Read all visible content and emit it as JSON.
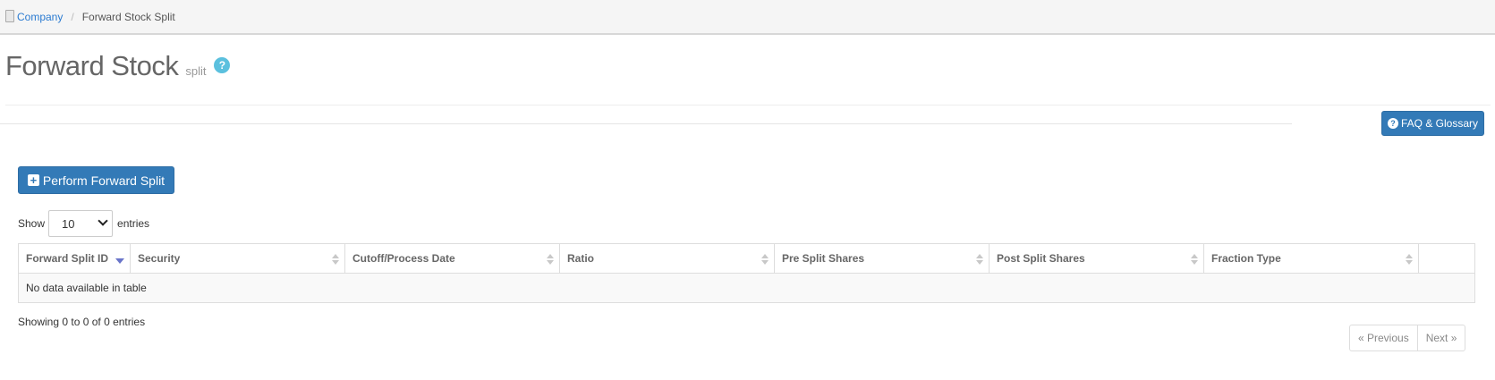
{
  "breadcrumb": {
    "items": [
      {
        "label": "Company"
      },
      {
        "label": "Forward Stock Split"
      }
    ],
    "separator": "/"
  },
  "header": {
    "title": "Forward Stock",
    "subtitle": "split",
    "help_glyph": "?"
  },
  "toolbar": {
    "faq_label": "FAQ & Glossary",
    "faq_icon_glyph": "?",
    "perform_label": "Perform Forward Split",
    "perform_icon_glyph": "+"
  },
  "length_menu": {
    "prefix": "Show",
    "selected": "10",
    "suffix": "entries"
  },
  "table": {
    "columns": [
      {
        "label": "Forward Split ID",
        "sort": "desc"
      },
      {
        "label": "Security",
        "sort": "both"
      },
      {
        "label": "Cutoff/Process Date",
        "sort": "both"
      },
      {
        "label": "Ratio",
        "sort": "both"
      },
      {
        "label": "Pre Split Shares",
        "sort": "both"
      },
      {
        "label": "Post Split Shares",
        "sort": "both"
      },
      {
        "label": "Fraction Type",
        "sort": "both"
      },
      {
        "label": "",
        "sort": "none"
      }
    ],
    "empty_message": "No data available in table",
    "info": "Showing 0 to 0 of 0 entries"
  },
  "pagination": {
    "previous": "« Previous",
    "next": "Next »"
  },
  "colors": {
    "primary": "#337ab7",
    "link": "#2b7bd1",
    "help": "#5bc0de"
  }
}
